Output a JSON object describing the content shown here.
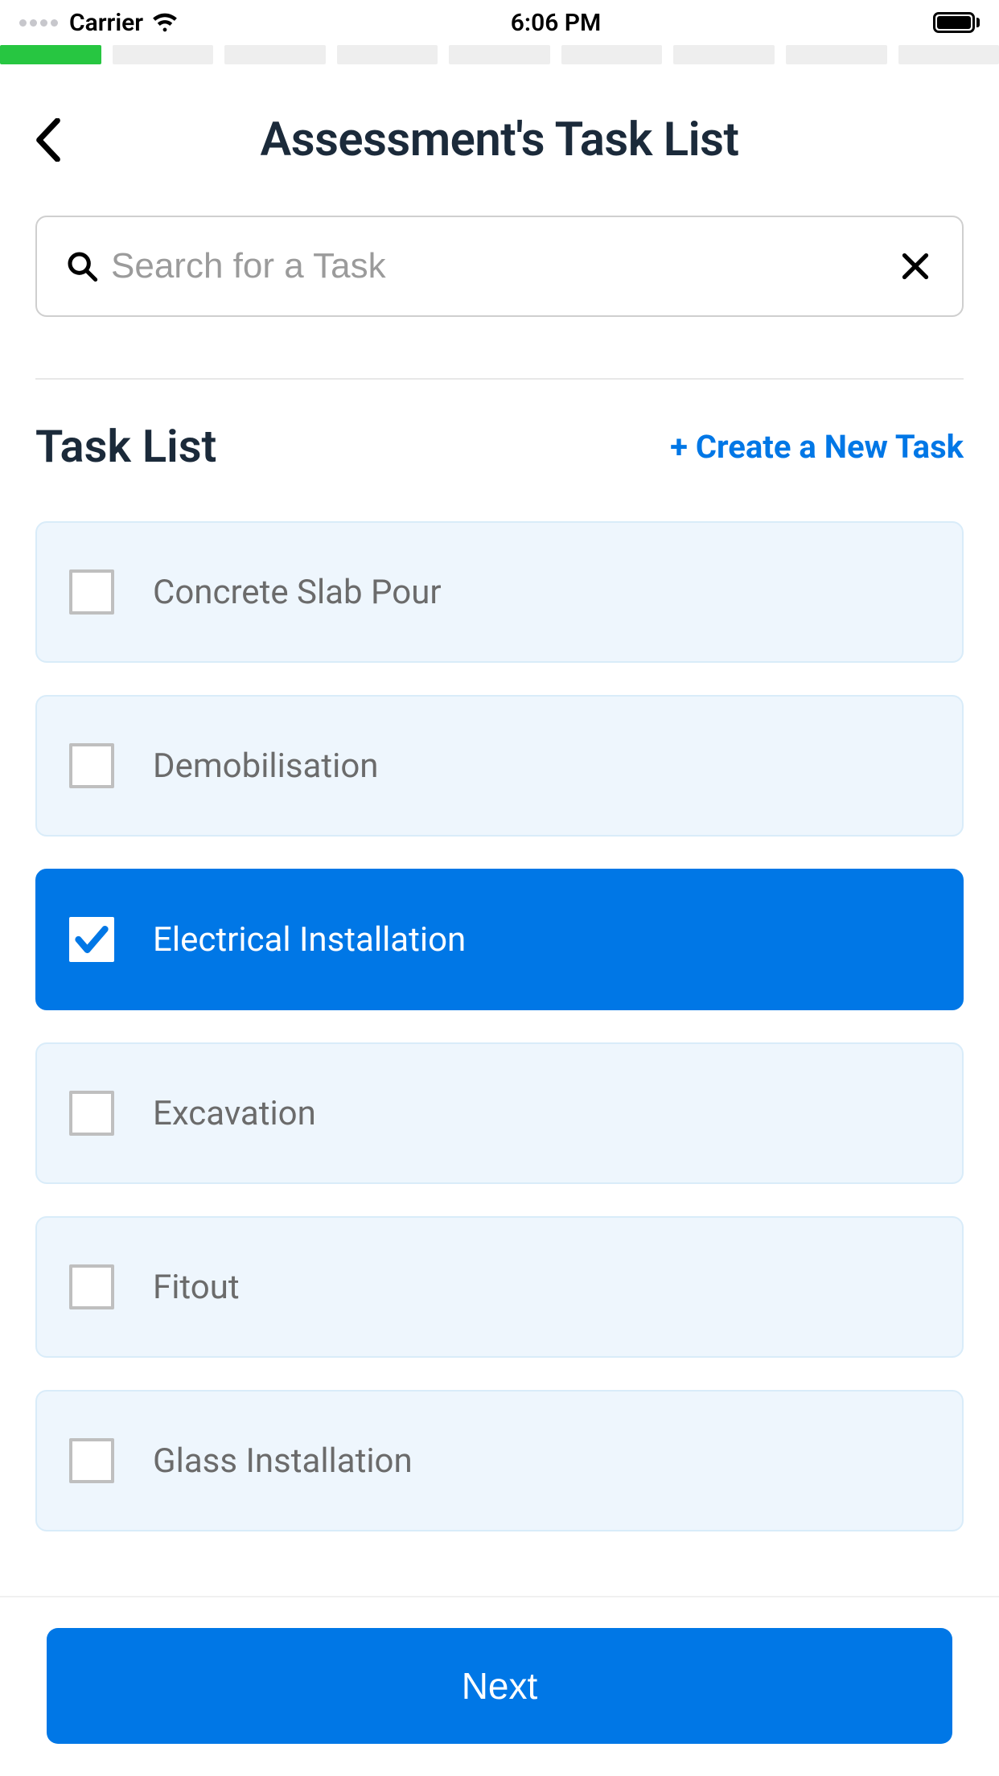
{
  "status_bar": {
    "carrier": "Carrier",
    "time": "6:06 PM"
  },
  "progress": {
    "total_segments": 9,
    "active_index": 0
  },
  "header": {
    "title": "Assessment's Task List"
  },
  "search": {
    "placeholder": "Search for a Task",
    "value": ""
  },
  "section": {
    "title": "Task List",
    "create_label": "+ Create a New Task"
  },
  "tasks": [
    {
      "label": "Concrete Slab Pour",
      "selected": false
    },
    {
      "label": "Demobilisation",
      "selected": false
    },
    {
      "label": "Electrical Installation",
      "selected": true
    },
    {
      "label": "Excavation",
      "selected": false
    },
    {
      "label": "Fitout",
      "selected": false
    },
    {
      "label": "Glass Installation",
      "selected": false
    }
  ],
  "footer": {
    "next_label": "Next"
  }
}
